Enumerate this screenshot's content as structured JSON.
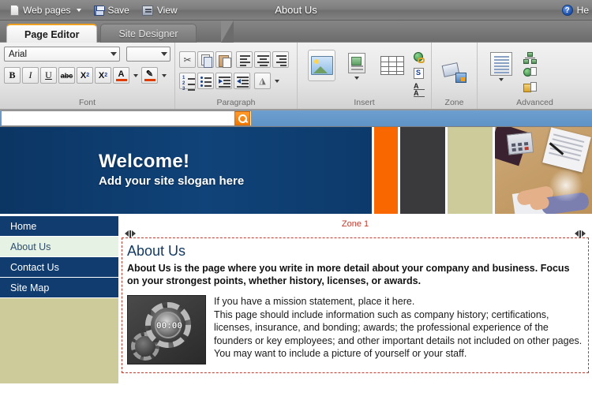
{
  "window": {
    "title": "About Us",
    "help_label": "He",
    "help_icon": "help-circle-icon"
  },
  "menubar": {
    "items": [
      {
        "label": "Web pages",
        "icon": "page-icon",
        "has_caret": true
      },
      {
        "label": "Save",
        "icon": "save-disk-icon",
        "has_caret": false
      },
      {
        "label": "View",
        "icon": "view-monitor-icon",
        "has_caret": false
      }
    ]
  },
  "tabs": [
    {
      "label": "Page Editor",
      "active": true
    },
    {
      "label": "Site Designer",
      "active": false
    }
  ],
  "ribbon": {
    "groups": [
      {
        "label": "Font",
        "font_family_value": "Arial",
        "font_size_value": "",
        "buttons": [
          {
            "name": "bold-button",
            "glyph": "B"
          },
          {
            "name": "italic-button",
            "glyph": "I"
          },
          {
            "name": "underline-button",
            "glyph": "U"
          },
          {
            "name": "strikethrough-button",
            "glyph": "abc"
          },
          {
            "name": "subscript-button",
            "glyph": "X"
          },
          {
            "name": "superscript-button",
            "glyph": "X"
          },
          {
            "name": "font-color-button",
            "glyph": "A"
          },
          {
            "name": "highlight-color-button",
            "glyph": "pen"
          }
        ]
      },
      {
        "label": "Paragraph",
        "buttons": [
          {
            "name": "cut-button"
          },
          {
            "name": "copy-button"
          },
          {
            "name": "paste-button"
          },
          {
            "name": "align-left-button"
          },
          {
            "name": "align-center-button"
          },
          {
            "name": "align-right-button"
          },
          {
            "name": "numbered-list-button"
          },
          {
            "name": "bullet-list-button"
          },
          {
            "name": "increase-indent-button"
          },
          {
            "name": "decrease-indent-button"
          },
          {
            "name": "fill-color-button"
          }
        ]
      },
      {
        "label": "Insert",
        "buttons": [
          {
            "name": "insert-image-button"
          },
          {
            "name": "insert-document-button"
          },
          {
            "name": "insert-table-button"
          },
          {
            "name": "insert-hyperlink-button"
          },
          {
            "name": "insert-form-button"
          },
          {
            "name": "insert-text-button"
          }
        ]
      },
      {
        "label": "Zone",
        "buttons": [
          {
            "name": "zone-properties-button"
          }
        ]
      },
      {
        "label": "Advanced",
        "buttons": [
          {
            "name": "advanced-layout-button"
          },
          {
            "name": "advanced-network-button"
          },
          {
            "name": "advanced-web-page-button"
          },
          {
            "name": "advanced-style-button"
          }
        ]
      }
    ]
  },
  "preview": {
    "search": {
      "value": "",
      "placeholder": "",
      "button_icon": "magnifier-icon"
    },
    "banner": {
      "title": "Welcome!",
      "subtitle": "Add your site slogan here",
      "swatch_colors": [
        "#f96800",
        "#3a3a3c",
        "#cdcb9a"
      ],
      "photo_alt": "business-handshake-photo"
    },
    "navigation": {
      "items": [
        {
          "label": "Home",
          "active": false
        },
        {
          "label": "About Us",
          "active": true
        },
        {
          "label": "Contact Us",
          "active": false
        },
        {
          "label": "Site Map",
          "active": false
        }
      ]
    },
    "zone": {
      "label": "Zone 1",
      "heading": "About Us",
      "intro": "About Us is the page where you write in more detail about your company and business. Focus on your strongest points, whether history, licenses, or awards.",
      "image_alt": "gears-clock-image",
      "image_digits": "00:00",
      "body_line_1": "If you have a mission statement, place it here.",
      "body_line_2": "This page should include information such as company history; certifications, licenses, insurance, and bonding; awards; the professional experience of the founders or key employees; and other important details not included on other pages. You may want to include a picture of yourself or your staff."
    }
  },
  "colors": {
    "accent_orange": "#f96800",
    "nav_blue": "#103c70",
    "zone_red": "#c0392b",
    "khaki": "#cdcb9a",
    "active_nav_bg": "#e6f2e3"
  }
}
